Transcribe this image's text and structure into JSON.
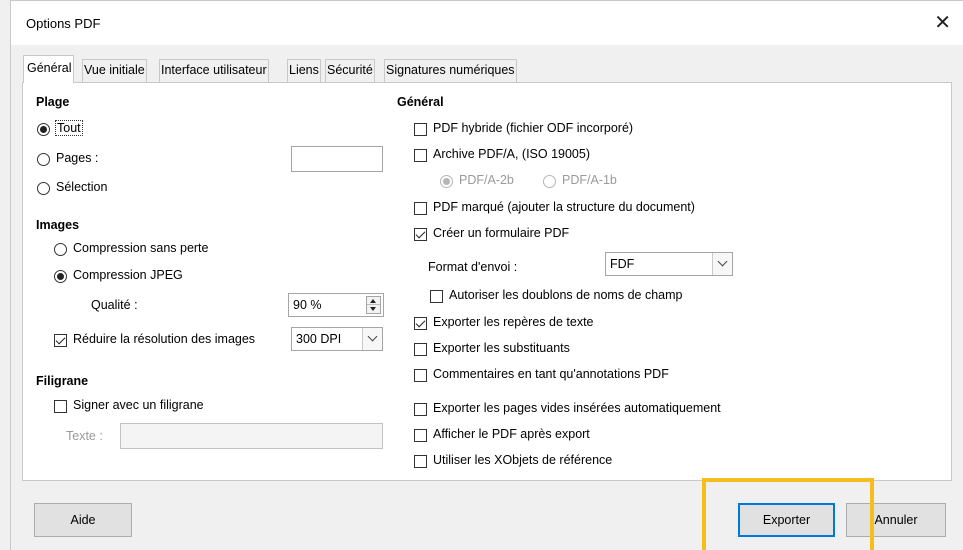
{
  "window": {
    "title": "Options PDF",
    "close_glyph": "✕"
  },
  "tabs": [
    {
      "label": "Général",
      "active": true
    },
    {
      "label": "Vue initiale"
    },
    {
      "label": "Interface utilisateur"
    },
    {
      "label": "Liens"
    },
    {
      "label": "Sécurité"
    },
    {
      "label": "Signatures numériques"
    }
  ],
  "plage": {
    "heading": "Plage",
    "tout": {
      "label": "Tout",
      "checked": true
    },
    "pages": {
      "label": "Pages :",
      "value": ""
    },
    "selection": {
      "label": "Sélection"
    }
  },
  "images": {
    "heading": "Images",
    "lossless": "Compression sans perte",
    "jpeg": "Compression JPEG",
    "quality_label": "Qualité :",
    "quality_value": "90 %",
    "reduce_label": "Réduire la résolution des images",
    "reduce_value": "300 DPI"
  },
  "filigrane": {
    "heading": "Filigrane",
    "sign_label": "Signer avec un filigrane",
    "text_label": "Texte :",
    "text_value": ""
  },
  "general": {
    "heading": "Général",
    "hybrid": "PDF hybride (fichier ODF incorporé)",
    "archive": "Archive PDF/A, (ISO 19005)",
    "pdfa2b": "PDF/A-2b",
    "pdfa1b": "PDF/A-1b",
    "tagged": "PDF marqué (ajouter la structure du document)",
    "create_form": "Créer un formulaire PDF",
    "format_label": "Format d'envoi :",
    "format_value": "FDF",
    "allow_duplicates": "Autoriser les doublons de noms de champ",
    "export_bookmarks": "Exporter les repères de texte",
    "export_placeholders": "Exporter les substituants",
    "comments": "Commentaires en tant qu'annotations PDF",
    "empty_pages": "Exporter les pages vides insérées automatiquement",
    "view_after": "Afficher le PDF après export",
    "xobjects": "Utiliser les XObjets de référence"
  },
  "buttons": {
    "help": "Aide",
    "export": "Exporter",
    "cancel": "Annuler"
  },
  "colors": {
    "highlight": "#f7bd1c",
    "default_border": "#0078d7"
  }
}
